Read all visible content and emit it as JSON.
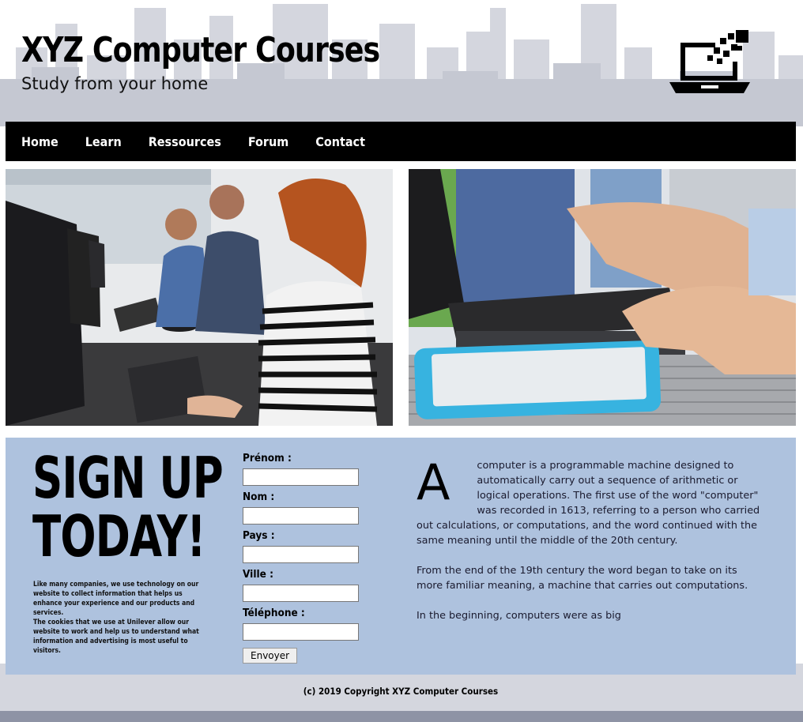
{
  "header": {
    "title": "XYZ Computer Courses",
    "tagline": "Study from your home",
    "logo_icon": "laptop-pixels-icon"
  },
  "nav": {
    "items": [
      {
        "label": "Home"
      },
      {
        "label": "Learn"
      },
      {
        "label": "Ressources"
      },
      {
        "label": "Forum"
      },
      {
        "label": "Contact"
      }
    ]
  },
  "images": {
    "left": "students-in-computer-lab",
    "right": "hands-laptop-tablet"
  },
  "signup": {
    "heading_line1": "SIGN UP",
    "heading_line2": "TODAY!",
    "cookie_text_1": "Like many companies, we use technology on our website to collect information that helps us enhance your experience and our products and services.",
    "cookie_text_2": "The cookies that we use at Unilever allow our website to work and help us to understand what information and advertising is most useful to visitors."
  },
  "form": {
    "fields": [
      {
        "label": "Prénom :",
        "value": ""
      },
      {
        "label": "Nom :",
        "value": ""
      },
      {
        "label": "Pays :",
        "value": ""
      },
      {
        "label": "Ville :",
        "value": ""
      },
      {
        "label": "Téléphone :",
        "value": ""
      }
    ],
    "submit_label": "Envoyer"
  },
  "article": {
    "dropcap": "A",
    "para1": "computer is a programmable machine designed to automatically carry out a sequence of arithmetic or logical operations. The first use of the word \"computer\" was recorded in 1613, referring to a person who carried out calculations, or computations, and the word continued with the same meaning until the middle of the 20th century.",
    "para2": "From the end of the 19th century the word began to take on its more familiar meaning, a machine that carries out computations.",
    "para3": "In the beginning, computers were as big"
  },
  "footer": {
    "copyright": "(c) 2019 Copyright XYZ Computer Courses"
  },
  "colors": {
    "nav_bg": "#000000",
    "band_bg": "#aec2de",
    "skyline": "#c9cbd6"
  }
}
